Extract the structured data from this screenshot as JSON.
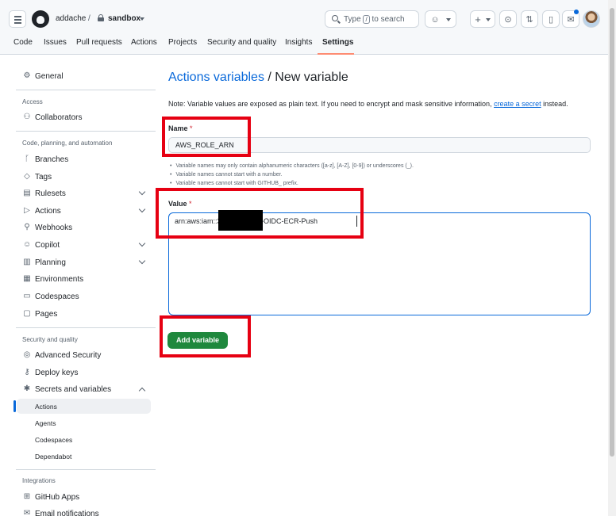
{
  "header": {
    "owner": "addache",
    "separator": "/",
    "repo": "sandbox",
    "search_prefix": "Type",
    "search_key": "/",
    "search_suffix": "to search"
  },
  "tabs": [
    {
      "label": "Code"
    },
    {
      "label": "Issues"
    },
    {
      "label": "Pull requests"
    },
    {
      "label": "Actions"
    },
    {
      "label": "Projects"
    },
    {
      "label": "Security and quality"
    },
    {
      "label": "Insights"
    },
    {
      "label": "Settings",
      "active": true
    }
  ],
  "sidebar": {
    "general": "General",
    "access_heading": "Access",
    "collaborators": "Collaborators",
    "code_heading": "Code, planning, and automation",
    "branches": "Branches",
    "tags": "Tags",
    "rulesets": "Rulesets",
    "actions": "Actions",
    "webhooks": "Webhooks",
    "copilot": "Copilot",
    "planning": "Planning",
    "environments": "Environments",
    "codespaces": "Codespaces",
    "pages": "Pages",
    "security_heading": "Security and quality",
    "advanced_security": "Advanced Security",
    "deploy_keys": "Deploy keys",
    "secrets_variables": "Secrets and variables",
    "sub": [
      "Actions",
      "Agents",
      "Codespaces",
      "Dependabot"
    ],
    "integrations_heading": "Integrations",
    "github_apps": "GitHub Apps",
    "email_notifications": "Email notifications"
  },
  "main": {
    "title_link": "Actions variables",
    "title_rest": " / New variable",
    "note_before": "Note: Variable values are exposed as plain text. If you need to encrypt and mask sensitive information, ",
    "note_link": "create a secret",
    "note_after": " instead.",
    "name_label": "Name",
    "required_mark": "*",
    "name_value": "AWS_ROLE_ARN",
    "hints": [
      "Variable names may only contain alphanumeric characters ([a-z], [A-Z], [0-9]) or underscores (_).",
      "Variable names cannot start with a number.",
      "Variable names cannot start with GITHUB_ prefix."
    ],
    "value_label": "Value",
    "value_text": "arn:aws:iam::3                    :role/GitHub-OIDC-ECR-Push",
    "add_button": "Add variable"
  },
  "colors": {
    "accent": "#0969da",
    "primary_button": "#1f883d",
    "annotation": "#e60012",
    "active_tab_underline": "#fd8c73"
  }
}
